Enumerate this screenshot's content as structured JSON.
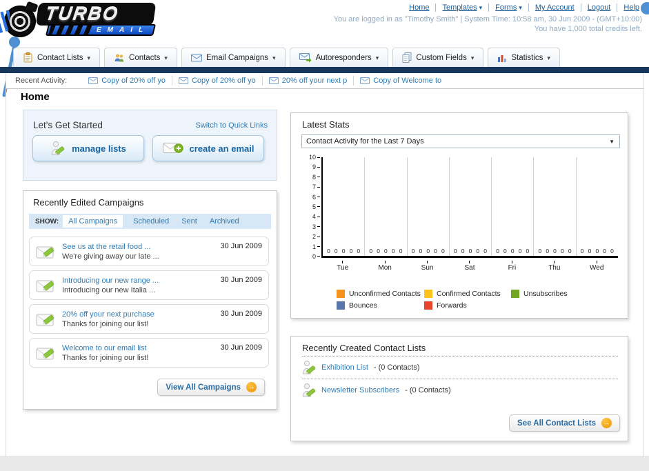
{
  "brand": {
    "title": "TURBO",
    "subtitle": "EMAIL"
  },
  "header": {
    "links": [
      {
        "label": "Home",
        "dropdown": false
      },
      {
        "label": "Templates",
        "dropdown": true
      },
      {
        "label": "Forms",
        "dropdown": true
      },
      {
        "label": "My Account",
        "dropdown": false
      },
      {
        "label": "Logout",
        "dropdown": false
      },
      {
        "label": "Help",
        "dropdown": false
      }
    ],
    "login_line": "You are logged in as \"Timothy Smith\" | System Time: 10:58 am, 30 Jun 2009 - (GMT+10:00)",
    "credits_line": "You have 1,000 total credits left."
  },
  "nav_tabs": [
    {
      "label": "Contact Lists",
      "icon": "contact-lists-icon"
    },
    {
      "label": "Contacts",
      "icon": "contacts-icon"
    },
    {
      "label": "Email Campaigns",
      "icon": "email-campaigns-icon"
    },
    {
      "label": "Autoresponders",
      "icon": "autoresponders-icon"
    },
    {
      "label": "Custom Fields",
      "icon": "custom-fields-icon"
    },
    {
      "label": "Statistics",
      "icon": "statistics-icon"
    }
  ],
  "recent_activity": {
    "label": "Recent Activity:",
    "items": [
      "Copy of 20% off yo",
      "Copy of 20% off yo",
      "20% off your next p",
      "Copy of Welcome to"
    ]
  },
  "page_title": "Home",
  "get_started": {
    "title": "Let's Get Started",
    "switch_link": "Switch to Quick Links",
    "manage_lists_label": "manage lists",
    "create_email_label": "create an email"
  },
  "campaigns": {
    "title": "Recently Edited Campaigns",
    "show_label": "SHOW:",
    "filters": [
      "All Campaigns",
      "Scheduled",
      "Sent",
      "Archived"
    ],
    "items": [
      {
        "title": "See us at the retail food ...",
        "subtitle": "We're giving away our late ...",
        "date": "30 Jun 2009"
      },
      {
        "title": "Introducing our new range ...",
        "subtitle": "Introducing our new Italia ...",
        "date": "30 Jun 2009"
      },
      {
        "title": "20% off your next purchase",
        "subtitle": "Thanks for joining our list!",
        "date": "30 Jun 2009"
      },
      {
        "title": "Welcome to our email list",
        "subtitle": "Thanks for joining our list!",
        "date": "30 Jun 2009"
      }
    ],
    "view_all_label": "View All Campaigns"
  },
  "stats": {
    "title": "Latest Stats",
    "dropdown_value": "Contact Activity for the Last 7 Days",
    "legend": [
      {
        "label": "Unconfirmed Contacts",
        "color": "#f5921e"
      },
      {
        "label": "Confirmed Contacts",
        "color": "#fdc31c"
      },
      {
        "label": "Unsubscribes",
        "color": "#73a623"
      },
      {
        "label": "Bounces",
        "color": "#5974a8"
      },
      {
        "label": "Forwards",
        "color": "#e8462c"
      }
    ]
  },
  "chart_data": {
    "type": "bar",
    "title": "Contact Activity for the Last 7 Days",
    "categories": [
      "Tue",
      "Mon",
      "Sun",
      "Sat",
      "Fri",
      "Thu",
      "Wed"
    ],
    "series": [
      {
        "name": "Unconfirmed Contacts",
        "values": [
          0,
          0,
          0,
          0,
          0,
          0,
          0
        ]
      },
      {
        "name": "Confirmed Contacts",
        "values": [
          0,
          0,
          0,
          0,
          0,
          0,
          0
        ]
      },
      {
        "name": "Unsubscribes",
        "values": [
          0,
          0,
          0,
          0,
          0,
          0,
          0
        ]
      },
      {
        "name": "Bounces",
        "values": [
          0,
          0,
          0,
          0,
          0,
          0,
          0
        ]
      },
      {
        "name": "Forwards",
        "values": [
          0,
          0,
          0,
          0,
          0,
          0,
          0
        ]
      }
    ],
    "ylim": [
      0,
      10
    ],
    "yticks": [
      0,
      1,
      2,
      3,
      4,
      5,
      6,
      7,
      8,
      9,
      10
    ],
    "grid": "vertical",
    "legend_position": "bottom"
  },
  "contact_lists": {
    "title": "Recently Created Contact Lists",
    "items": [
      {
        "name": "Exhibition List",
        "detail": "- (0 Contacts)"
      },
      {
        "name": "Newsletter Subscribers",
        "detail": "- (0 Contacts)"
      }
    ],
    "see_all_label": "See All Contact Lists"
  },
  "colors": {
    "accent_blue": "#2f7cb5",
    "navy_bar": "#16365c",
    "link_dark": "#1a5e9a",
    "decor_blue": "#4f90d2"
  }
}
